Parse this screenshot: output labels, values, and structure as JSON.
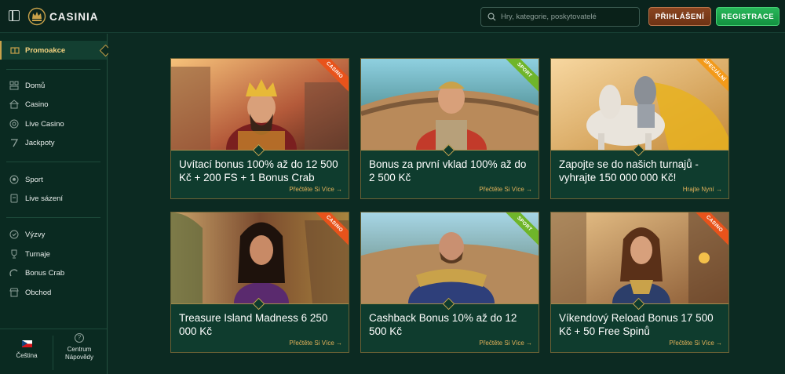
{
  "header": {
    "brand": "CASINIA",
    "search_placeholder": "Hry, kategorie, poskytovatelé",
    "login_label": "PŘIHLÁŠENÍ",
    "register_label": "REGISTRACE"
  },
  "sidebar": {
    "active": {
      "label": "Promoakce",
      "icon": "gift-box-icon"
    },
    "group1": [
      {
        "label": "Domů",
        "icon": "grid-icon"
      },
      {
        "label": "Casino",
        "icon": "casino-building-icon"
      },
      {
        "label": "Live Casino",
        "icon": "live-chip-icon"
      },
      {
        "label": "Jackpoty",
        "icon": "seven-icon"
      }
    ],
    "group2": [
      {
        "label": "Sport",
        "icon": "soccer-ball-icon"
      },
      {
        "label": "Live sázení",
        "icon": "live-bet-icon"
      }
    ],
    "group3": [
      {
        "label": "Výzvy",
        "icon": "challenge-icon"
      },
      {
        "label": "Turnaje",
        "icon": "trophy-icon"
      },
      {
        "label": "Bonus Crab",
        "icon": "crab-claw-icon"
      },
      {
        "label": "Obchod",
        "icon": "shop-icon"
      }
    ],
    "footer": {
      "language_label": "Čeština",
      "help_label_line1": "Centrum",
      "help_label_line2": "Nápovědy"
    }
  },
  "promotions": [
    {
      "title": "Uvítací bonus 100% až do 12 500 Kč + 200 FS + 1 Bonus Crab",
      "link": "Přečtěte Si Více",
      "badge": "CASINO",
      "badge_color": "#e8531b"
    },
    {
      "title": "Bonus za první vklad 100% až do 2 500 Kč",
      "link": "Přečtěte Si Více",
      "badge": "SPORT",
      "badge_color": "#6fb52a"
    },
    {
      "title": "Zapojte se do našich turnajů - vyhrajte 150 000 000 Kč!",
      "link": "Hrajte Nyní",
      "badge": "SPECIÁLNÍ",
      "badge_color": "#f39a1a"
    },
    {
      "title": "Treasure Island Madness 6 250 000 Kč",
      "link": "Přečtěte Si Více",
      "badge": "CASINO",
      "badge_color": "#e8531b"
    },
    {
      "title": "Cashback Bonus 10% až do 12 500 Kč",
      "link": "Přečtěte Si Více",
      "badge": "SPORT",
      "badge_color": "#6fb52a"
    },
    {
      "title": "Víkendový Reload Bonus 17 500 Kč + 50 Free Spinů",
      "link": "Přečtěte Si Více",
      "badge": "CASINO",
      "badge_color": "#e8531b"
    }
  ],
  "colors": {
    "background": "#0c2a22",
    "sidebar": "#0a2a21",
    "gold_accent": "#c9a24a",
    "login_button": "#7a3a18",
    "register_button": "#1ea84d"
  }
}
